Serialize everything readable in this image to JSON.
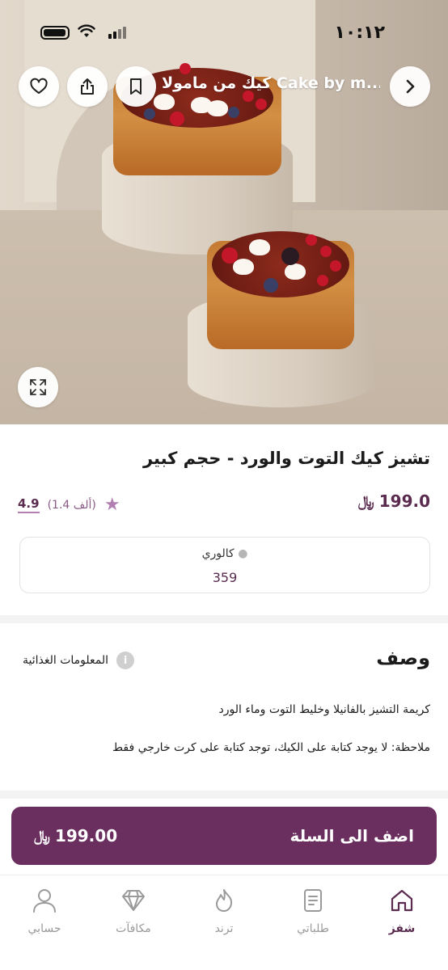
{
  "status": {
    "time": "١٠:١٢"
  },
  "header": {
    "title": "كيك من ماموﻻ Cake by m..."
  },
  "product": {
    "title": "تشيز كيك التوت والورد - حجم كبير",
    "price": "199.0",
    "currency_symbol": "﷼",
    "rating": "4.9",
    "rating_count": "(1.4 ألف)",
    "calories_label": "كالوري",
    "calories_value": "359"
  },
  "description": {
    "title": "وصف",
    "nutrition_label": "المعلومات الغذائية",
    "text": "كريمة التشيز بالفانيلا وخليط التوت وماء الورد",
    "note": "ملاحظة: لا يوجد كتابة على الكيك، توجد كتابة على كرت خارجي فقط"
  },
  "cart": {
    "label": "اضف الى السلة",
    "price": "199.00"
  },
  "tabs": [
    {
      "label": "شفز",
      "icon": "home-icon",
      "active": true
    },
    {
      "label": "طلباتي",
      "icon": "orders-icon",
      "active": false
    },
    {
      "label": "ترند",
      "icon": "trend-icon",
      "active": false
    },
    {
      "label": "مكافآت",
      "icon": "diamond-icon",
      "active": false
    },
    {
      "label": "حسابي",
      "icon": "user-icon",
      "active": false
    }
  ],
  "colors": {
    "accent": "#6a2e5f",
    "accent_light": "#b27fb3"
  }
}
